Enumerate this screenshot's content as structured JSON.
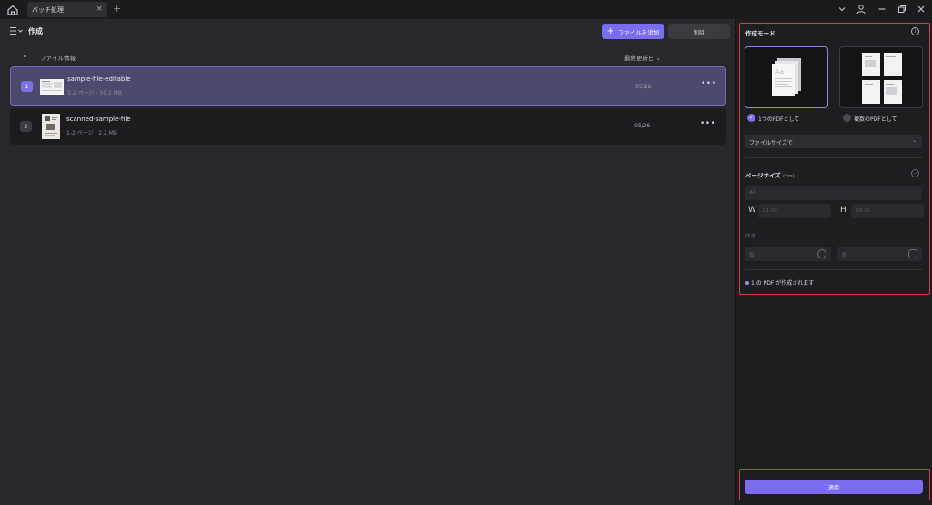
{
  "titlebar": {
    "tab_label": "バッチ処理",
    "close_glyph": "×",
    "add_glyph": "+"
  },
  "toolbar": {
    "title": "作成",
    "add_file_label": "ファイルを追加",
    "delete_label": "削除"
  },
  "columns": {
    "file_info": "ファイル情報",
    "last_modified": "最終更新日 ⌄"
  },
  "files": [
    {
      "index": "1",
      "name": "sample-file-editable",
      "meta": "1-2 ページ · 16.2 MB",
      "date": "05/26",
      "more": "•••",
      "selected": true
    },
    {
      "index": "2",
      "name": "scanned-sample-file",
      "meta": "1-2 ページ · 2.2 MB",
      "date": "05/26",
      "more": "•••",
      "selected": false
    }
  ],
  "side": {
    "mode_title": "作成モード",
    "info_glyph": "i",
    "option_single": "1つのPDFとして",
    "option_multiple": "複数のPDFとして",
    "dropdown_value": "ファイルサイズで",
    "dropdown_caret": "⌄",
    "page_size_title": "ページサイズ",
    "page_size_unit": "(cm)",
    "page_size_value": "A4",
    "width_label": "W",
    "height_label": "H",
    "width_value": "21.00",
    "height_value": "29.70",
    "orientation_label": "向き",
    "orientation_portrait": "縦",
    "orientation_landscape": "横",
    "summary": "1 の PDF が作成されます",
    "apply_label": "適用"
  },
  "colors": {
    "accent": "#7a6df0",
    "highlight": "#e03a40",
    "selected_row": "#4b4a6e"
  },
  "icons": {
    "home": "home-icon",
    "list": "list-icon",
    "account": "account-icon",
    "minimize": "minimize-icon",
    "restore": "restore-icon",
    "close": "close-icon",
    "more": "more-horizontal-icon",
    "info": "info-icon",
    "check": "check-icon"
  }
}
